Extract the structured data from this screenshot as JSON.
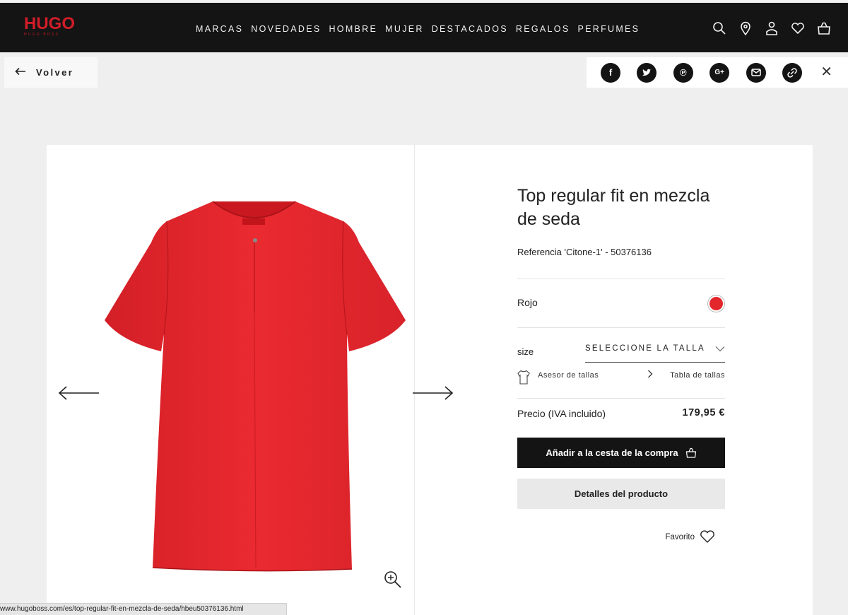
{
  "header": {
    "logo_text": "HUGO",
    "logo_subtext": "HUGO BOSS",
    "nav": [
      "MARCAS",
      "NOVEDADES",
      "HOMBRE",
      "MUJER",
      "DESTACADOS",
      "REGALOS",
      "PERFUMES"
    ],
    "icons": [
      "search-icon",
      "location-icon",
      "account-icon",
      "wishlist-heart-icon",
      "shopping-bag-icon"
    ]
  },
  "back": {
    "label": "Volver"
  },
  "share": {
    "icons": [
      "facebook-icon",
      "twitter-icon",
      "pinterest-icon",
      "google-plus-icon",
      "email-icon",
      "link-icon"
    ],
    "facebook": "f",
    "pinterest": "℗",
    "googleplus": "G+",
    "close": "✕"
  },
  "product": {
    "title": "Top regular fit en mezcla de seda",
    "reference": "Referencia 'Citone-1' - 50376136",
    "color_label": "Rojo",
    "color_hex": "#e3262b",
    "size_label": "size",
    "size_select": "SELECCIONE LA TALLA",
    "size_advisor": "Asesor de tallas",
    "size_table": "Tabla de tallas",
    "price_label": "Precio (IVA incluido)",
    "price": "179,95 €",
    "add_to_cart": "Añadir a la cesta de la compra",
    "details": "Detalles del producto",
    "favorite": "Favorito"
  },
  "status_url": "www.hugoboss.com/es/top-regular-fit-en-mezcla-de-seda/hbeu50376136.html"
}
